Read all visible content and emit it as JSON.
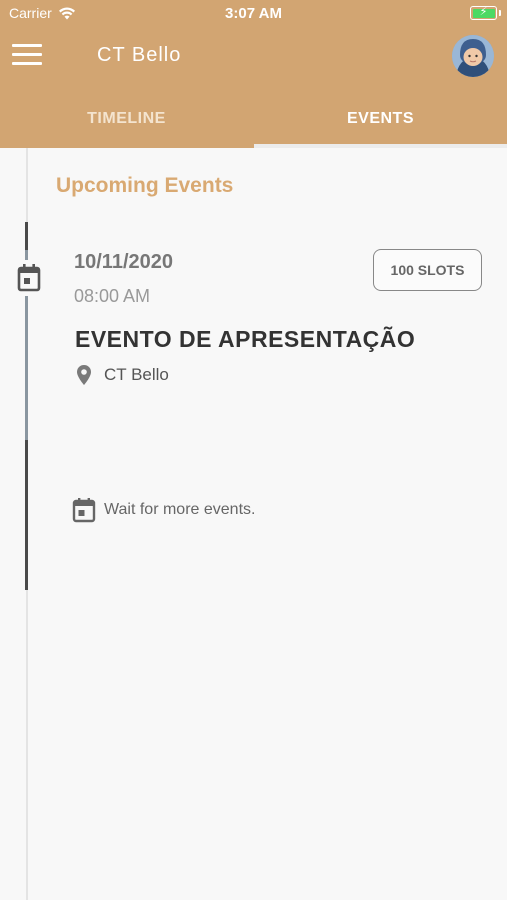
{
  "status_bar": {
    "carrier": "Carrier",
    "time": "3:07 AM",
    "battery_icon": "battery-charging-icon"
  },
  "app_bar": {
    "title": "CT Bello",
    "menu_icon": "hamburger-menu-icon",
    "avatar": "user-avatar"
  },
  "tabs": [
    {
      "label": "TIMELINE",
      "active": false
    },
    {
      "label": "EVENTS",
      "active": true
    }
  ],
  "section": {
    "title": "Upcoming Events"
  },
  "events": [
    {
      "date": "10/11/2020",
      "time": "08:00 AM",
      "slots": "100 SLOTS",
      "title": "EVENTO DE APRESENTAÇÃO",
      "location": "CT Bello"
    }
  ],
  "footer_note": "Wait for more events.",
  "colors": {
    "brand": "#d2a572",
    "section_title": "#d9a972",
    "background": "#f8f8f8"
  }
}
